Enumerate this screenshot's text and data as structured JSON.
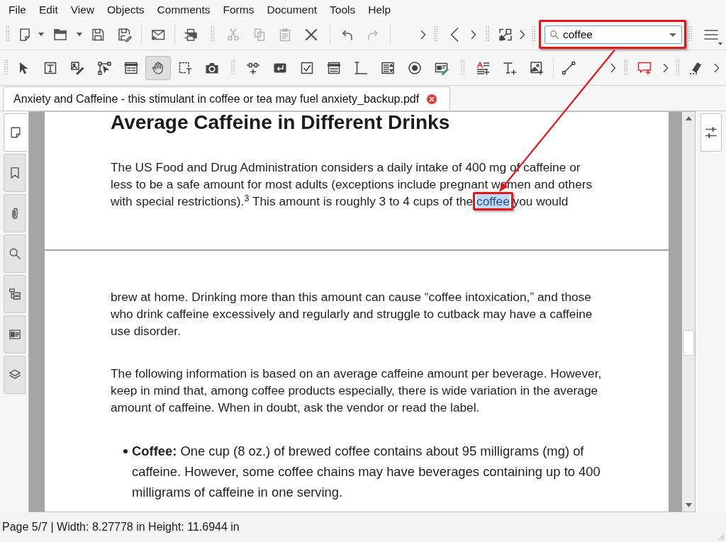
{
  "menu_bar": {
    "items": [
      "File",
      "Edit",
      "View",
      "Objects",
      "Comments",
      "Forms",
      "Document",
      "Tools",
      "Help"
    ]
  },
  "main_toolbar": {
    "buttons": [
      {
        "disabled": false
      },
      {
        "disabled": false
      },
      {
        "disabled": false
      },
      {
        "disabled": false
      },
      {
        "disabled": false
      },
      {
        "disabled": false
      },
      {
        "disabled": true
      },
      {
        "disabled": true
      },
      {
        "disabled": true
      },
      {
        "disabled": false
      },
      {
        "disabled": false
      },
      {
        "disabled": true
      }
    ],
    "search_field": {
      "value": "coffee"
    }
  },
  "tools_toolbar": {
    "tools": [
      {
        "selected": false
      },
      {
        "selected": false
      },
      {
        "selected": false
      },
      {
        "selected": false
      },
      {
        "selected": false
      },
      {
        "selected": true
      },
      {
        "selected": false
      },
      {
        "selected": false
      },
      {
        "selected": false
      },
      {
        "selected": false
      },
      {
        "selected": false
      },
      {
        "selected": false
      },
      {
        "selected": false
      },
      {
        "selected": false
      },
      {
        "selected": false
      },
      {
        "selected": false
      },
      {
        "selected": false
      },
      {
        "selected": false
      },
      {
        "selected": false
      },
      {
        "selected": false
      },
      {
        "selected": false
      },
      {
        "selected": false
      }
    ]
  },
  "document_tabs": [
    {
      "title": "Anxiety and Caffeine - this stimulant in coffee or tea may fuel anxiety_backup.pdf",
      "selected": true
    }
  ],
  "left_panel": {
    "tabs": [
      {
        "selected": true
      },
      {
        "selected": false
      },
      {
        "selected": false
      },
      {
        "selected": false
      },
      {
        "selected": false
      },
      {
        "selected": false
      },
      {
        "selected": false
      }
    ]
  },
  "document": {
    "pages": [
      {
        "blocks": [
          {
            "kind": "heading",
            "text": "Average Caffeine in Different Drinks"
          },
          {
            "kind": "paragraph",
            "lines": [
              [
                {
                  "text": "The US Food and Drug Administration considers a daily intake of 400 mg of caffeine or",
                  "highlighted": false
                }
              ],
              [
                {
                  "text": "less to be a safe amount for most adults (exceptions include pregnant women and others",
                  "highlighted": false
                }
              ],
              [
                {
                  "text": "with special restrictions).$^{3}$ This amount is roughly 3 to 4 cups of the ",
                  "highlighted": false
                },
                {
                  "text": "coffee",
                  "highlighted": true
                },
                {
                  "text": " you would",
                  "highlighted": false
                }
              ]
            ]
          }
        ]
      },
      {
        "blocks": [
          {
            "kind": "paragraph",
            "lines": [
              [
                {
                  "text": "brew at home. Drinking more than this amount can cause “coffee intoxication,” and those",
                  "highlighted": false
                }
              ],
              [
                {
                  "text": "who drink caffeine excessively and regularly and struggle to cutback may have a caffeine",
                  "highlighted": false
                }
              ],
              [
                {
                  "text": "use disorder.",
                  "highlighted": false
                }
              ]
            ]
          },
          {
            "kind": "paragraph",
            "lines": [
              [
                {
                  "text": "The following information is based on an average caffeine amount per beverage. However,",
                  "highlighted": false
                }
              ],
              [
                {
                  "text": "keep in mind that, among coffee products especially, there is wide variation in the average",
                  "highlighted": false
                }
              ],
              [
                {
                  "text": "amount of caffeine. When in doubt, ask the vendor or read the label.",
                  "highlighted": false
                }
              ]
            ]
          },
          {
            "kind": "bullet",
            "lines": [
              [
                {
                  "text": "**Coffee:** One cup (8 oz.) of brewed coffee contains about 95 milligrams (mg) of",
                  "highlighted": false
                }
              ],
              [
                {
                  "text": "caffeine. However, some coffee chains may have beverages containing up to 400",
                  "highlighted": false
                }
              ],
              [
                {
                  "text": "milligrams of caffeine in one serving.",
                  "highlighted": false
                }
              ]
            ]
          }
        ]
      }
    ]
  },
  "right_panel": {
    "tabs": [
      {
        "selected": true
      }
    ]
  },
  "status_bar": {
    "text": "Page 5/7 | Width: 8.27778 in Height: 11.6944 in"
  }
}
